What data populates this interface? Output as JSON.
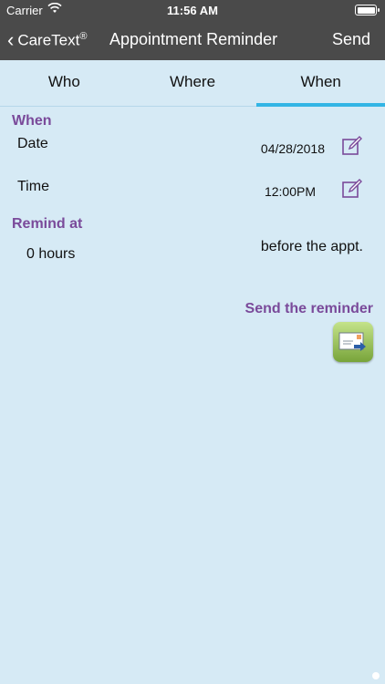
{
  "status_bar": {
    "carrier": "Carrier",
    "time": "11:56 AM"
  },
  "nav": {
    "back_label": "CareText",
    "back_label_mark": "®",
    "title": "Appointment Reminder",
    "send_label": "Send"
  },
  "tabs": [
    {
      "label": "Who"
    },
    {
      "label": "Where"
    },
    {
      "label": "When",
      "active": true
    }
  ],
  "when": {
    "section_label": "When",
    "date_label": "Date",
    "date_value": "04/28/2018",
    "time_label": "Time",
    "time_value": "12:00PM"
  },
  "remind": {
    "section_label": "Remind at",
    "hours_value": "0 hours",
    "suffix": "before the appt."
  },
  "send_reminder": {
    "label": "Send the reminder"
  },
  "colors": {
    "header_bg": "#4a4a4a",
    "page_bg": "#d6eaf5",
    "accent_text": "#7a4a9a",
    "tab_indicator": "#33b5e5"
  }
}
